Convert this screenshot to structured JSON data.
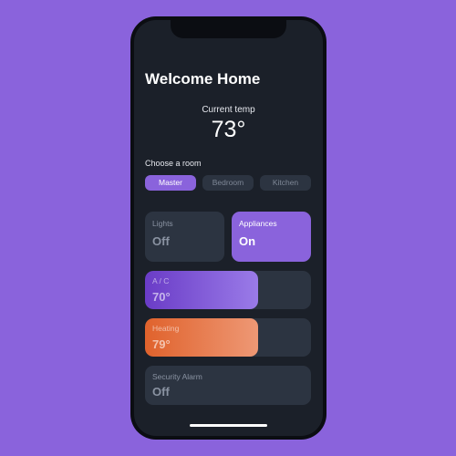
{
  "header": {
    "title": "Welcome Home"
  },
  "thermostat": {
    "label": "Current temp",
    "value": "73°"
  },
  "rooms": {
    "label": "Choose a room",
    "tabs": [
      {
        "label": "Master",
        "active": true
      },
      {
        "label": "Bedroom",
        "active": false
      },
      {
        "label": "Kitchen",
        "active": false
      }
    ]
  },
  "devices": {
    "lights": {
      "label": "Lights",
      "value": "Off"
    },
    "appliances": {
      "label": "Appliances",
      "value": "On"
    },
    "ac": {
      "label": "A / C",
      "value": "70°",
      "level_pct": 68
    },
    "heating": {
      "label": "Heating",
      "value": "79°",
      "level_pct": 68
    },
    "alarm": {
      "label": "Security Alarm",
      "value": "Off"
    }
  },
  "colors": {
    "background": "#8a63dc",
    "accent": "#8a63dc",
    "card": "#2c3441",
    "screen": "#1b2029",
    "heating": "#e0622c"
  }
}
